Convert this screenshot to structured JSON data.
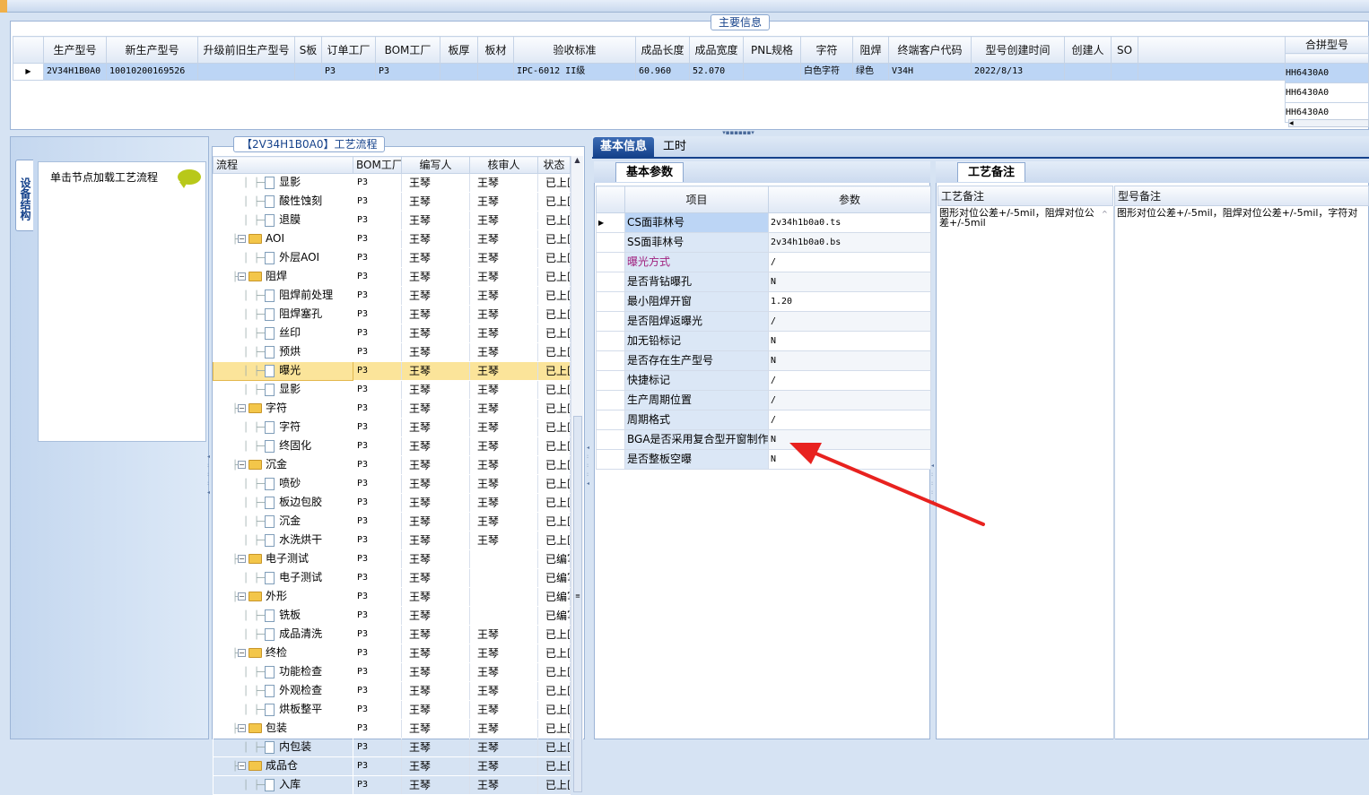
{
  "main_section_title": "主要信息",
  "top_grid": {
    "columns": [
      "生产型号",
      "新生产型号",
      "升级前旧生产型号",
      "S板",
      "订单工厂",
      "BOM工厂",
      "板厚",
      "板材",
      "验收标准",
      "成品长度",
      "成品宽度",
      "PNL规格",
      "字符",
      "阻焊",
      "终端客户代码",
      "型号创建时间",
      "创建人",
      "SO"
    ],
    "row": [
      "2V34H1B0A0",
      "10010200169526",
      "",
      "",
      "P3",
      "P3",
      "",
      "",
      "IPC-6012 II级",
      "60.960",
      "52.070",
      "",
      "白色字符",
      "绿色",
      "V34H",
      "2022/8/13",
      "",
      ""
    ]
  },
  "merge_grid": {
    "header": "合拼型号",
    "rows": [
      "HH6430A0",
      "HH6430A0",
      "HH6430A0"
    ]
  },
  "device_tab_label": "设备结构",
  "load_hint": "单击节点加载工艺流程",
  "process_title": "【2V34H1B0A0】工艺流程",
  "tree": {
    "columns": [
      "流程",
      "BOM工厂",
      "编写人",
      "核审人",
      "状态"
    ],
    "rows": [
      {
        "level": 2,
        "type": "doc",
        "name": "显影",
        "bom": "P3",
        "writer": "王琴",
        "reviewer": "王琴",
        "status": "已上区"
      },
      {
        "level": 2,
        "type": "doc",
        "name": "酸性蚀刻",
        "bom": "P3",
        "writer": "王琴",
        "reviewer": "王琴",
        "status": "已上区"
      },
      {
        "level": 2,
        "type": "doc",
        "name": "退膜",
        "bom": "P3",
        "writer": "王琴",
        "reviewer": "王琴",
        "status": "已上区"
      },
      {
        "level": 1,
        "type": "folder",
        "name": "AOI",
        "bom": "P3",
        "writer": "王琴",
        "reviewer": "王琴",
        "status": "已上区"
      },
      {
        "level": 2,
        "type": "doc",
        "name": "外层AOI",
        "bom": "P3",
        "writer": "王琴",
        "reviewer": "王琴",
        "status": "已上区"
      },
      {
        "level": 1,
        "type": "folder",
        "name": "阻焊",
        "bom": "P3",
        "writer": "王琴",
        "reviewer": "王琴",
        "status": "已上区"
      },
      {
        "level": 2,
        "type": "doc",
        "name": "阻焊前处理",
        "bom": "P3",
        "writer": "王琴",
        "reviewer": "王琴",
        "status": "已上区"
      },
      {
        "level": 2,
        "type": "doc",
        "name": "阻焊塞孔",
        "bom": "P3",
        "writer": "王琴",
        "reviewer": "王琴",
        "status": "已上区"
      },
      {
        "level": 2,
        "type": "doc",
        "name": "丝印",
        "bom": "P3",
        "writer": "王琴",
        "reviewer": "王琴",
        "status": "已上区"
      },
      {
        "level": 2,
        "type": "doc",
        "name": "预烘",
        "bom": "P3",
        "writer": "王琴",
        "reviewer": "王琴",
        "status": "已上区"
      },
      {
        "level": 2,
        "type": "doc",
        "name": "曝光",
        "bom": "P3",
        "writer": "王琴",
        "reviewer": "王琴",
        "status": "已上区",
        "selected": true
      },
      {
        "level": 2,
        "type": "doc",
        "name": "显影",
        "bom": "P3",
        "writer": "王琴",
        "reviewer": "王琴",
        "status": "已上区"
      },
      {
        "level": 1,
        "type": "folder",
        "name": "字符",
        "bom": "P3",
        "writer": "王琴",
        "reviewer": "王琴",
        "status": "已上区"
      },
      {
        "level": 2,
        "type": "doc",
        "name": "字符",
        "bom": "P3",
        "writer": "王琴",
        "reviewer": "王琴",
        "status": "已上区"
      },
      {
        "level": 2,
        "type": "doc",
        "name": "终固化",
        "bom": "P3",
        "writer": "王琴",
        "reviewer": "王琴",
        "status": "已上区"
      },
      {
        "level": 1,
        "type": "folder",
        "name": "沉金",
        "bom": "P3",
        "writer": "王琴",
        "reviewer": "王琴",
        "status": "已上区"
      },
      {
        "level": 2,
        "type": "doc",
        "name": "喷砂",
        "bom": "P3",
        "writer": "王琴",
        "reviewer": "王琴",
        "status": "已上区"
      },
      {
        "level": 2,
        "type": "doc",
        "name": "板边包胶",
        "bom": "P3",
        "writer": "王琴",
        "reviewer": "王琴",
        "status": "已上区"
      },
      {
        "level": 2,
        "type": "doc",
        "name": "沉金",
        "bom": "P3",
        "writer": "王琴",
        "reviewer": "王琴",
        "status": "已上区"
      },
      {
        "level": 2,
        "type": "doc",
        "name": "水洗烘干",
        "bom": "P3",
        "writer": "王琴",
        "reviewer": "王琴",
        "status": "已上区"
      },
      {
        "level": 1,
        "type": "folder",
        "name": "电子测试",
        "bom": "P3",
        "writer": "王琴",
        "reviewer": "",
        "status": "已编写"
      },
      {
        "level": 2,
        "type": "doc",
        "name": "电子测试",
        "bom": "P3",
        "writer": "王琴",
        "reviewer": "",
        "status": "已编写"
      },
      {
        "level": 1,
        "type": "folder",
        "name": "外形",
        "bom": "P3",
        "writer": "王琴",
        "reviewer": "",
        "status": "已编写"
      },
      {
        "level": 2,
        "type": "doc",
        "name": "铣板",
        "bom": "P3",
        "writer": "王琴",
        "reviewer": "",
        "status": "已编写"
      },
      {
        "level": 2,
        "type": "doc",
        "name": "成品清洗",
        "bom": "P3",
        "writer": "王琴",
        "reviewer": "王琴",
        "status": "已上区"
      },
      {
        "level": 1,
        "type": "folder",
        "name": "终检",
        "bom": "P3",
        "writer": "王琴",
        "reviewer": "王琴",
        "status": "已上区"
      },
      {
        "level": 2,
        "type": "doc",
        "name": "功能检查",
        "bom": "P3",
        "writer": "王琴",
        "reviewer": "王琴",
        "status": "已上区"
      },
      {
        "level": 2,
        "type": "doc",
        "name": "外观检查",
        "bom": "P3",
        "writer": "王琴",
        "reviewer": "王琴",
        "status": "已上区"
      },
      {
        "level": 2,
        "type": "doc",
        "name": "烘板整平",
        "bom": "P3",
        "writer": "王琴",
        "reviewer": "王琴",
        "status": "已上区"
      },
      {
        "level": 1,
        "type": "folder",
        "name": "包装",
        "bom": "P3",
        "writer": "王琴",
        "reviewer": "王琴",
        "status": "已上区"
      },
      {
        "level": 2,
        "type": "doc",
        "name": "内包装",
        "bom": "P3",
        "writer": "王琴",
        "reviewer": "王琴",
        "status": "已上区"
      },
      {
        "level": 1,
        "type": "folder",
        "name": "成品仓",
        "bom": "P3",
        "writer": "王琴",
        "reviewer": "王琴",
        "status": "已上区"
      },
      {
        "level": 2,
        "type": "doc",
        "name": "入库",
        "bom": "P3",
        "writer": "王琴",
        "reviewer": "王琴",
        "status": "已上区"
      }
    ]
  },
  "tabs": [
    "基本信息",
    "工时"
  ],
  "basic_params_tab": "基本参数",
  "params_grid": {
    "columns": [
      "项目",
      "参数"
    ],
    "rows": [
      {
        "item": "CS面菲林号",
        "value": "2v34h1b0a0.ts"
      },
      {
        "item": "SS面菲林号",
        "value": "2v34h1b0a0.bs"
      },
      {
        "item": "曝光方式",
        "value": "/",
        "highlight": true
      },
      {
        "item": "是否背钻曝孔",
        "value": "N"
      },
      {
        "item": "最小阻焊开窗",
        "value": "1.20"
      },
      {
        "item": "是否阻焊返曝光",
        "value": "/"
      },
      {
        "item": "加无铅标记",
        "value": "N"
      },
      {
        "item": "是否存在生产型号",
        "value": "N"
      },
      {
        "item": "快捷标记",
        "value": "/"
      },
      {
        "item": "生产周期位置",
        "value": "/"
      },
      {
        "item": "周期格式",
        "value": "/"
      },
      {
        "item": "BGA是否采用复合型开窗制作",
        "value": "N"
      },
      {
        "item": "是否整板空曝",
        "value": "N"
      }
    ]
  },
  "process_remark_tab": "工艺备注",
  "remarks": {
    "col1_header": "工艺备注",
    "col2_header": "型号备注",
    "col1_text": "图形对位公差+/-5mil，阻焊对位公差+/-5mil",
    "col2_text": "图形对位公差+/-5mil，阻焊对位公差+/-5mil，字符对"
  },
  "colors": {
    "accent": "#15428b",
    "selected_row": "#bcd5f5",
    "tree_selected": "#fbe49a",
    "annotation_arrow": "#e8221f",
    "highlight_text": "#a0207e"
  }
}
